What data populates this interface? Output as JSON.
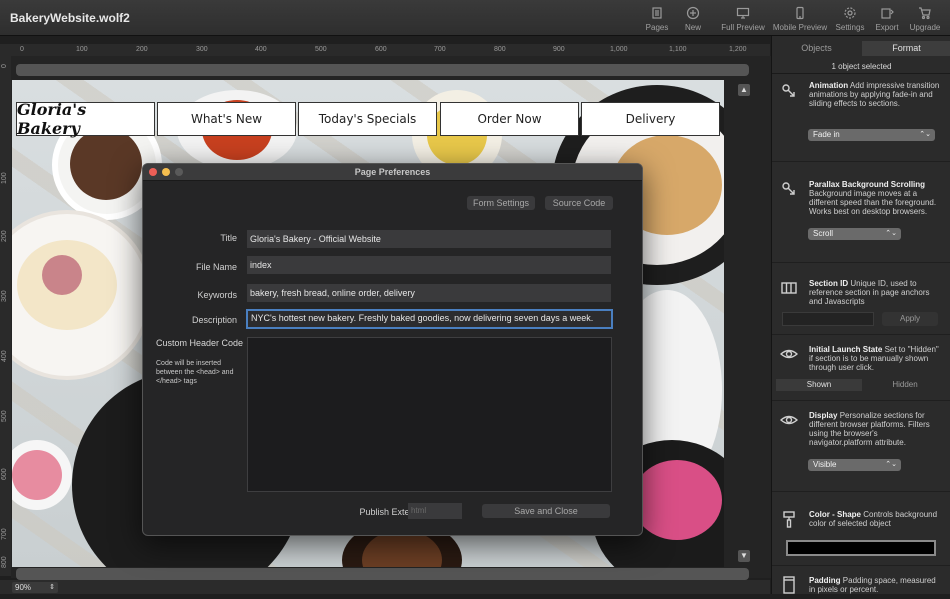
{
  "app": {
    "title": "BakeryWebsite.wolf2"
  },
  "toolbar": {
    "buttons": [
      {
        "label": "Pages",
        "icon": "pages-icon"
      },
      {
        "label": "New",
        "icon": "plus-circle-icon"
      },
      {
        "label": "Full Preview",
        "icon": "monitor-icon"
      },
      {
        "label": "Mobile Preview",
        "icon": "phone-icon"
      },
      {
        "label": "Settings",
        "icon": "gear-icon"
      },
      {
        "label": "Export",
        "icon": "export-icon"
      },
      {
        "label": "Upgrade",
        "icon": "cart-icon"
      }
    ]
  },
  "ruler": {
    "top_ticks": [
      "0",
      "100",
      "200",
      "300",
      "400",
      "500",
      "600",
      "700",
      "800",
      "900",
      "1,000",
      "1,100",
      "1,200"
    ],
    "left_ticks": [
      "0",
      "100",
      "200",
      "300",
      "400",
      "500",
      "600",
      "700",
      "800"
    ]
  },
  "website": {
    "logo": "Gloria's Bakery",
    "nav": [
      "What's New",
      "Today's Specials",
      "Order Now",
      "Delivery"
    ]
  },
  "statusbar": {
    "zoom": "90%"
  },
  "dialog": {
    "title": "Page Preferences",
    "buttons": {
      "form_settings": "Form Settings",
      "source_code": "Source Code",
      "save_close": "Save and Close"
    },
    "fields": {
      "title_label": "Title",
      "title_value": "Gloria's Bakery - Official Website",
      "filename_label": "File Name",
      "filename_value": "index",
      "keywords_label": "Keywords",
      "keywords_value": "bakery, fresh bread, online order, delivery",
      "description_label": "Description",
      "description_value": "NYC's hottest new bakery.  Freshly baked goodies, now delivering seven days a week.",
      "header_code_label": "Custom Header Code",
      "header_code_note": "Code will be inserted between the <head> and </head> tags",
      "publish_ext_label": "Publish Extension",
      "publish_ext_placeholder": "html"
    }
  },
  "panel": {
    "tabs": [
      "Objects",
      "Format"
    ],
    "selected_count": "1 object selected",
    "sections": [
      {
        "name": "Animation",
        "desc": "Add impressive transition animations by applying fade-in and sliding effects to sections.",
        "icon": "animation-icon",
        "value": "Fade in"
      },
      {
        "name": "Parallax Background Scrolling",
        "desc": "Background image moves at a different speed than the foreground. Works best on desktop browsers.",
        "icon": "parallax-icon",
        "value": "Scroll"
      },
      {
        "name": "Section ID",
        "desc": "Unique ID, used to reference section in page anchors and Javascripts",
        "icon": "section-id-icon",
        "apply": "Apply"
      },
      {
        "name": "Initial Launch State",
        "desc": "Set to \"Hidden\" if section is to be manually shown through user click.",
        "icon": "eye-icon",
        "options": [
          "Shown",
          "Hidden"
        ]
      },
      {
        "name": "Display",
        "desc": "Personalize sections for different browser platforms.  Filters using the browser's navigator.platform attribute.",
        "icon": "eye-icon",
        "value": "Visible"
      },
      {
        "name": "Color - Shape",
        "desc": "Controls background color of selected object",
        "icon": "paint-roller-icon",
        "color": "#000000"
      },
      {
        "name": "Padding",
        "desc": "Padding space, measured in pixels or percent.",
        "icon": "padding-icon"
      }
    ]
  }
}
